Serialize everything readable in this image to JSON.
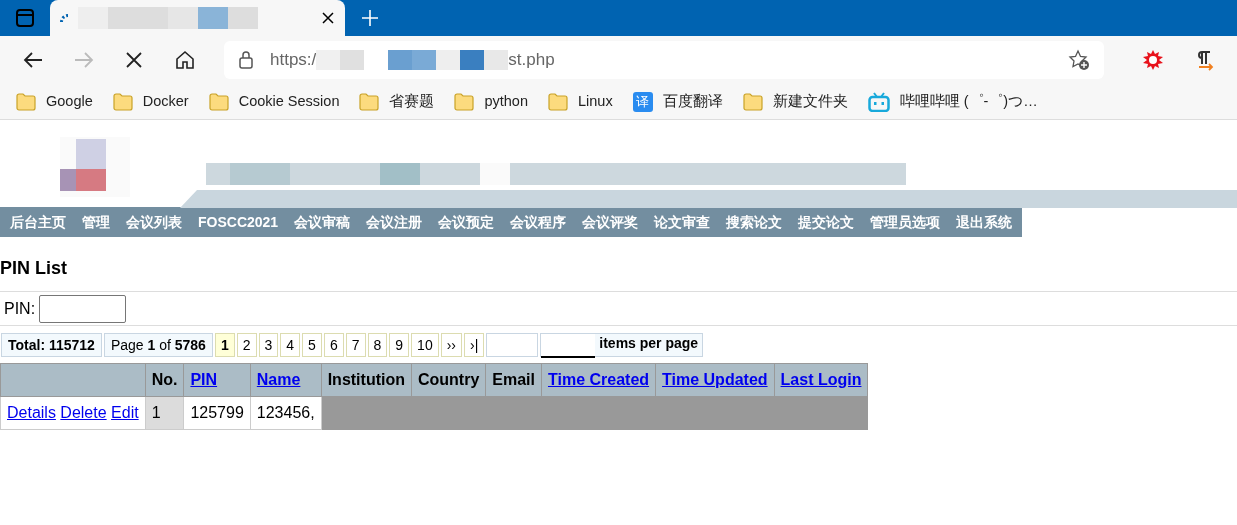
{
  "browser": {
    "url": {
      "start": "https:/",
      "end": "st.php"
    },
    "bookmarks": [
      {
        "label": "Google",
        "kind": "folder"
      },
      {
        "label": "Docker",
        "kind": "folder"
      },
      {
        "label": "Cookie  Session",
        "kind": "folder"
      },
      {
        "label": "省赛题",
        "kind": "folder"
      },
      {
        "label": "python",
        "kind": "folder"
      },
      {
        "label": "Linux",
        "kind": "folder"
      },
      {
        "label": "百度翻译",
        "kind": "translate",
        "icon_text": "译"
      },
      {
        "label": "新建文件夹",
        "kind": "folder"
      },
      {
        "label": "哔哩哔哩 (゜-゜)つ…",
        "kind": "tv"
      }
    ]
  },
  "nav": [
    "后台主页",
    "管理",
    "会议列表",
    "FOSCC2021",
    "会议审稿",
    "会议注册",
    "会议预定",
    "会议程序",
    "会议评奖",
    "论文审查",
    "搜索论文",
    "提交论文",
    "管理员选项",
    "退出系统"
  ],
  "page_title": "PIN List",
  "filter": {
    "label": "PIN:"
  },
  "pager": {
    "total": "Total: 115712",
    "page_info": "Page **1** of **5786**",
    "pages": [
      {
        "label": "1",
        "selected": true
      },
      {
        "label": "2",
        "selected": false
      },
      {
        "label": "3",
        "selected": false
      },
      {
        "label": "4",
        "selected": false
      },
      {
        "label": "5",
        "selected": false
      },
      {
        "label": "6",
        "selected": false
      },
      {
        "label": "7",
        "selected": false
      },
      {
        "label": "8",
        "selected": false
      },
      {
        "label": "9",
        "selected": false
      },
      {
        "label": "10",
        "selected": false
      },
      {
        "label": "››",
        "selected": false
      },
      {
        "label": "›|",
        "selected": false
      }
    ],
    "per_page_label": "items per page"
  },
  "table": {
    "columns": [
      {
        "sortable": false
      },
      {
        "label": "No.",
        "sortable": false
      },
      {
        "label": "PIN",
        "sortable": true
      },
      {
        "label": "Name",
        "sortable": true
      },
      {
        "label": "Institution",
        "sortable": false
      },
      {
        "label": "Country",
        "sortable": false
      },
      {
        "label": "Email",
        "sortable": false
      },
      {
        "label": "Time Created",
        "sortable": true
      },
      {
        "label": "Time Updated",
        "sortable": true
      },
      {
        "label": "Last Login",
        "sortable": true
      }
    ],
    "rows": [
      {
        "actions": [
          "Details",
          "Delete",
          "Edit"
        ],
        "no": "1",
        "pin": "125799",
        "name": "123456,"
      }
    ]
  }
}
